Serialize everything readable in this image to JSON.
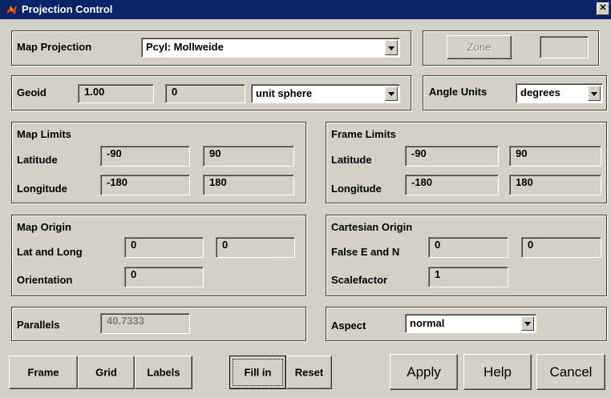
{
  "window": {
    "title": "Projection Control",
    "close_glyph": "✕"
  },
  "projection": {
    "label": "Map Projection",
    "selected": "Pcyl: Mollweide"
  },
  "zone": {
    "button_label": "Zone",
    "value": ""
  },
  "geoid": {
    "label": "Geoid",
    "radius": "1.00",
    "eccentricity": "0",
    "selected": "unit sphere"
  },
  "angle_units": {
    "label": "Angle Units",
    "selected": "degrees"
  },
  "map_limits": {
    "title": "Map Limits",
    "latitude_label": "Latitude",
    "lat_min": "-90",
    "lat_max": "90",
    "longitude_label": "Longitude",
    "lon_min": "-180",
    "lon_max": "180"
  },
  "frame_limits": {
    "title": "Frame Limits",
    "latitude_label": "Latitude",
    "lat_min": "-90",
    "lat_max": "90",
    "longitude_label": "Longitude",
    "lon_min": "-180",
    "lon_max": "180"
  },
  "map_origin": {
    "title": "Map Origin",
    "latlong_label": "Lat and Long",
    "lat": "0",
    "long": "0",
    "orientation_label": "Orientation",
    "orientation": "0"
  },
  "cartesian_origin": {
    "title": "Cartesian Origin",
    "false_en_label": "False E and N",
    "false_e": "0",
    "false_n": "0",
    "scalefactor_label": "Scalefactor",
    "scalefactor": "1"
  },
  "parallels": {
    "label": "Parallels",
    "value": "40.7333"
  },
  "aspect": {
    "label": "Aspect",
    "selected": "normal"
  },
  "buttons": {
    "frame": "Frame",
    "grid": "Grid",
    "labels": "Labels",
    "fill_in": "Fill in",
    "reset": "Reset",
    "apply": "Apply",
    "help": "Help",
    "cancel": "Cancel"
  },
  "colors": {
    "titlebar": "#0a246a",
    "face": "#d4d0c8",
    "disabled_text": "#808080"
  }
}
